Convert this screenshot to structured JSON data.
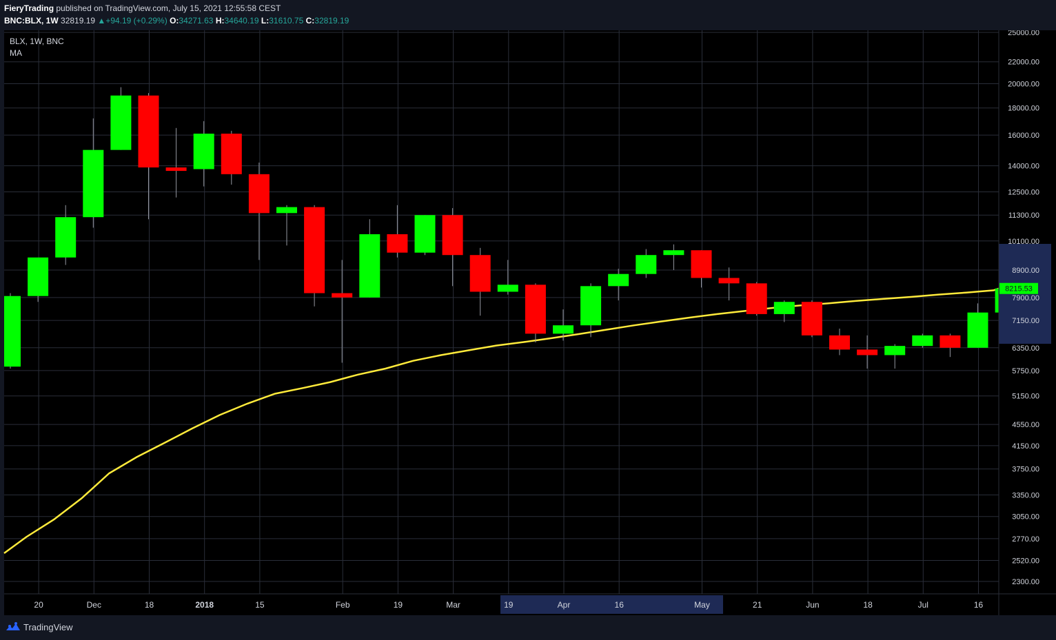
{
  "header": {
    "author": "FieryTrading",
    "published": "published on TradingView.com, July 15, 2021 12:55:58 CEST",
    "symbol": "BNC:BLX, 1W",
    "last": "32819.19",
    "change": "+94.19 (+0.29%)",
    "o_label": "O:",
    "o_value": "34271.63",
    "h_label": "H:",
    "h_value": "34640.19",
    "l_label": "L:",
    "l_value": "31610.75",
    "c_label": "C:",
    "c_value": "32819.19"
  },
  "legend": {
    "symbol": "BLX, 1W, BNC",
    "indicator": "MA"
  },
  "footer": {
    "brand": "TradingView"
  },
  "colors": {
    "up": "#00ff00",
    "down": "#ff0000",
    "ma": "#ffeb3b",
    "bg": "#000000",
    "grid": "#2a2e39",
    "axis_text": "#d1d4dc",
    "highlight": "#1e2a55"
  },
  "chart_data": {
    "type": "candlestick",
    "y_scale": "log",
    "ylim": [
      2200,
      25500
    ],
    "y_ticks": [
      "25000.00",
      "22000.00",
      "20000.00",
      "18000.00",
      "16000.00",
      "14000.00",
      "12500.00",
      "11300.00",
      "10100.00",
      "8900.00",
      "7900.00",
      "7150.00",
      "6350.00",
      "5750.00",
      "5150.00",
      "4550.00",
      "4150.00",
      "3750.00",
      "3350.00",
      "3050.00",
      "2770.00",
      "2520.00",
      "2300.00"
    ],
    "x_ticks": [
      {
        "label": "20",
        "index": 1
      },
      {
        "label": "Dec",
        "index": 3
      },
      {
        "label": "18",
        "index": 5
      },
      {
        "label": "2018",
        "index": 7
      },
      {
        "label": "15",
        "index": 9
      },
      {
        "label": "Feb",
        "index": 12
      },
      {
        "label": "19",
        "index": 14
      },
      {
        "label": "Mar",
        "index": 16
      },
      {
        "label": "19",
        "index": 18
      },
      {
        "label": "Apr",
        "index": 20
      },
      {
        "label": "16",
        "index": 22
      },
      {
        "label": "May",
        "index": 25
      },
      {
        "label": "21",
        "index": 27
      },
      {
        "label": "Jun",
        "index": 29
      },
      {
        "label": "18",
        "index": 31
      },
      {
        "label": "Jul",
        "index": 33
      },
      {
        "label": "16",
        "index": 35
      }
    ],
    "candles": [
      {
        "o": 5850,
        "h": 8050,
        "l": 5800,
        "c": 7950
      },
      {
        "o": 7950,
        "h": 9300,
        "l": 7750,
        "c": 9400
      },
      {
        "o": 9400,
        "h": 11800,
        "l": 9100,
        "c": 11200
      },
      {
        "o": 11200,
        "h": 17200,
        "l": 10700,
        "c": 15000
      },
      {
        "o": 15000,
        "h": 19700,
        "l": 15000,
        "c": 19000
      },
      {
        "o": 19000,
        "h": 19200,
        "l": 11100,
        "c": 13900
      },
      {
        "o": 13900,
        "h": 16500,
        "l": 12200,
        "c": 13800
      },
      {
        "o": 13800,
        "h": 17000,
        "l": 12800,
        "c": 16100
      },
      {
        "o": 16100,
        "h": 16300,
        "l": 12900,
        "c": 13500
      },
      {
        "o": 13500,
        "h": 14200,
        "l": 9300,
        "c": 11400
      },
      {
        "o": 11400,
        "h": 11800,
        "l": 9900,
        "c": 11700
      },
      {
        "o": 11700,
        "h": 11800,
        "l": 7600,
        "c": 8050
      },
      {
        "o": 8050,
        "h": 9300,
        "l": 5950,
        "c": 7900
      },
      {
        "o": 7900,
        "h": 11100,
        "l": 7900,
        "c": 10400
      },
      {
        "o": 10400,
        "h": 11800,
        "l": 9400,
        "c": 9600
      },
      {
        "o": 9600,
        "h": 11300,
        "l": 9500,
        "c": 11300
      },
      {
        "o": 11300,
        "h": 11650,
        "l": 8300,
        "c": 9500
      },
      {
        "o": 9500,
        "h": 9800,
        "l": 7300,
        "c": 8100
      },
      {
        "o": 8100,
        "h": 9300,
        "l": 8000,
        "c": 8350
      },
      {
        "o": 8350,
        "h": 8400,
        "l": 6500,
        "c": 6750
      },
      {
        "o": 6750,
        "h": 7500,
        "l": 6550,
        "c": 7000
      },
      {
        "o": 7000,
        "h": 8400,
        "l": 6650,
        "c": 8300
      },
      {
        "o": 8300,
        "h": 8950,
        "l": 7800,
        "c": 8750
      },
      {
        "o": 8750,
        "h": 9750,
        "l": 8600,
        "c": 9500
      },
      {
        "o": 9500,
        "h": 9950,
        "l": 8900,
        "c": 9700
      },
      {
        "o": 9700,
        "h": 9700,
        "l": 8250,
        "c": 8600
      },
      {
        "o": 8600,
        "h": 9000,
        "l": 7800,
        "c": 8400
      },
      {
        "o": 8400,
        "h": 8450,
        "l": 7300,
        "c": 7350
      },
      {
        "o": 7350,
        "h": 7800,
        "l": 7100,
        "c": 7750
      },
      {
        "o": 7750,
        "h": 7800,
        "l": 6650,
        "c": 6700
      },
      {
        "o": 6700,
        "h": 6900,
        "l": 6150,
        "c": 6300
      },
      {
        "o": 6300,
        "h": 6700,
        "l": 5800,
        "c": 6150
      },
      {
        "o": 6150,
        "h": 6450,
        "l": 5800,
        "c": 6400
      },
      {
        "o": 6400,
        "h": 6750,
        "l": 6350,
        "c": 6700
      },
      {
        "o": 6700,
        "h": 6750,
        "l": 6100,
        "c": 6350
      },
      {
        "o": 6350,
        "h": 7700,
        "l": 6350,
        "c": 7400
      },
      {
        "o": 7400,
        "h": 8400,
        "l": 7400,
        "c": 8215
      }
    ],
    "ma": [
      2600,
      2790,
      3010,
      3300,
      3680,
      3950,
      4200,
      4470,
      4740,
      4980,
      5200,
      5330,
      5470,
      5650,
      5800,
      6000,
      6150,
      6280,
      6410,
      6510,
      6620,
      6740,
      6870,
      7000,
      7120,
      7240,
      7350,
      7450,
      7550,
      7630,
      7700,
      7780,
      7850,
      7920,
      8000,
      8070,
      8150,
      8215
    ],
    "last_price_label": "8215.53"
  }
}
